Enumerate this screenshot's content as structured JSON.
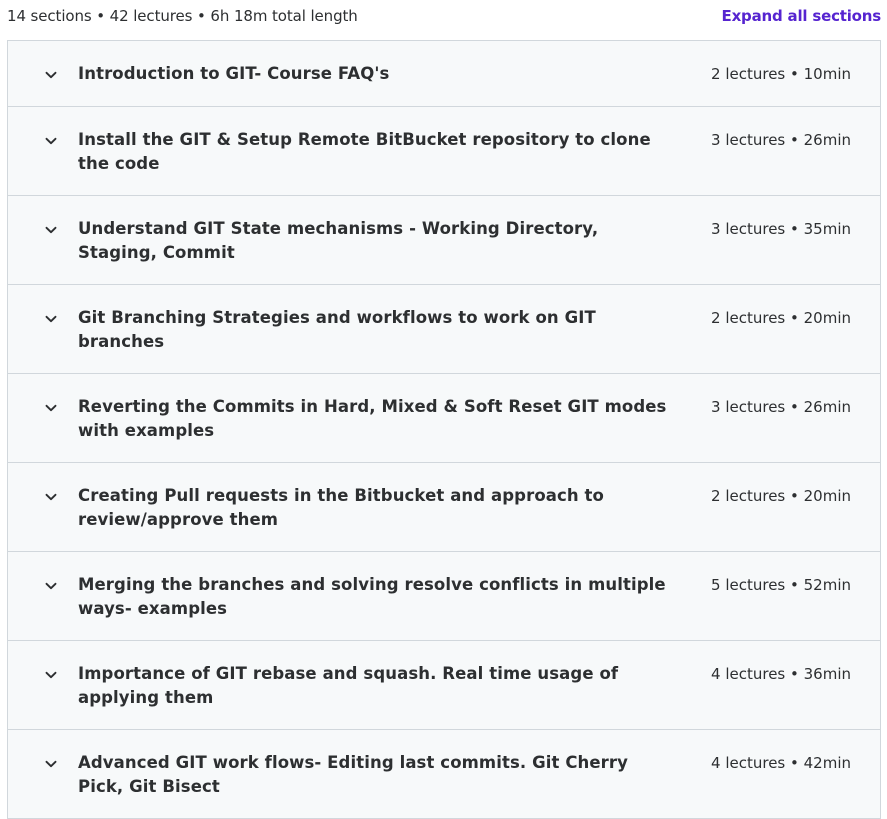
{
  "header": {
    "summary": "14 sections • 42 lectures • 6h 18m total length",
    "expand_all_label": "Expand all sections"
  },
  "colors": {
    "accent": "#5624d0",
    "section_bg": "#f7f9fa",
    "border": "#d1d7dc",
    "text": "#2d2f31"
  },
  "icons": {
    "section_toggle": "chevron-down-icon"
  },
  "sections": [
    {
      "title": "Introduction to GIT- Course FAQ's",
      "meta": "2 lectures • 10min"
    },
    {
      "title": "Install the GIT & Setup Remote BitBucket repository to clone the code",
      "meta": "3 lectures • 26min"
    },
    {
      "title": "Understand GIT State mechanisms - Working Directory, Staging, Commit",
      "meta": "3 lectures • 35min"
    },
    {
      "title": "Git Branching Strategies and workflows to work on GIT branches",
      "meta": "2 lectures • 20min"
    },
    {
      "title": "Reverting the Commits in Hard, Mixed & Soft Reset GIT modes with examples",
      "meta": "3 lectures • 26min"
    },
    {
      "title": "Creating Pull requests in the Bitbucket and approach to review/approve them",
      "meta": "2 lectures • 20min"
    },
    {
      "title": "Merging the branches and solving resolve conflicts in multiple ways- examples",
      "meta": "5 lectures • 52min"
    },
    {
      "title": "Importance of GIT rebase and squash. Real time usage of applying them",
      "meta": "4 lectures • 36min"
    },
    {
      "title": "Advanced GIT work flows- Editing last commits. Git Cherry Pick, Git Bisect",
      "meta": "4 lectures • 42min"
    }
  ]
}
